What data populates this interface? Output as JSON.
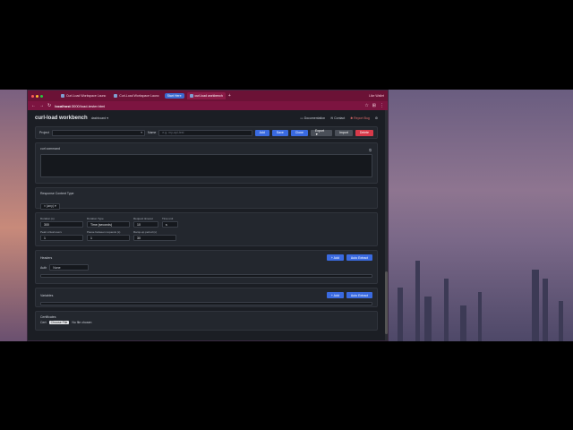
{
  "browser": {
    "tabs": [
      {
        "label": "Curl-Load Workspace Launc"
      },
      {
        "label": "Curl-Load Workspace Launc"
      },
      {
        "label": "curl-load workbench"
      }
    ],
    "tab_group_label": "Start Here",
    "new_tab": "+",
    "profile_label": "Like Wallet",
    "url_host": "localhost",
    "url_path": ":3000/load-tester.html",
    "nav": {
      "back": "←",
      "forward": "→",
      "reload": "↻"
    }
  },
  "header": {
    "title": "curl-load workbench",
    "dashboard": "dashboard ▾",
    "documentation": "Documentation",
    "contact": "Contact",
    "report_bug": "Report Bug",
    "settings_glyph": "⚙"
  },
  "toolbar": {
    "project_label": "Project",
    "name_label": "Name",
    "name_placeholder": "e.g. my-api-test",
    "add": "Add",
    "save": "Save",
    "clone": "Clone",
    "export": "Export ▼",
    "import": "Import",
    "delete": "Delete"
  },
  "curl": {
    "label": "curl command",
    "copy_glyph": "⧉"
  },
  "content_type": {
    "label": "Response Content Type",
    "value": "× (any) ▾"
  },
  "params": {
    "duration_label": "Duration (s)",
    "duration_value": "300",
    "duration_type_label": "Duration Type",
    "duration_type_value": "Time (seconds)",
    "request_timeout_label": "Request timeout",
    "request_timeout_value": "10",
    "time_unit_label": "Time unit",
    "time_unit_value": "s",
    "peak_threads_label": "Peak virtual users",
    "peak_threads_value": "1",
    "pause_label": "Pause between requests (s)",
    "pause_value": "1",
    "ramp_label": "Ramp-up period (s)",
    "ramp_value": "30"
  },
  "headers_section": {
    "title": "Headers",
    "add": "+ Add",
    "auto_extract": "Auto Extract",
    "auth_label": "Auth",
    "auth_value": "None"
  },
  "variables_section": {
    "title": "Variables",
    "add": "+ Add",
    "auto_extract": "Auto Extract"
  },
  "certificates_section": {
    "title": "Certificates",
    "cert_label": "Cert",
    "choose_file": "Choose File",
    "no_file": "No file chosen"
  }
}
